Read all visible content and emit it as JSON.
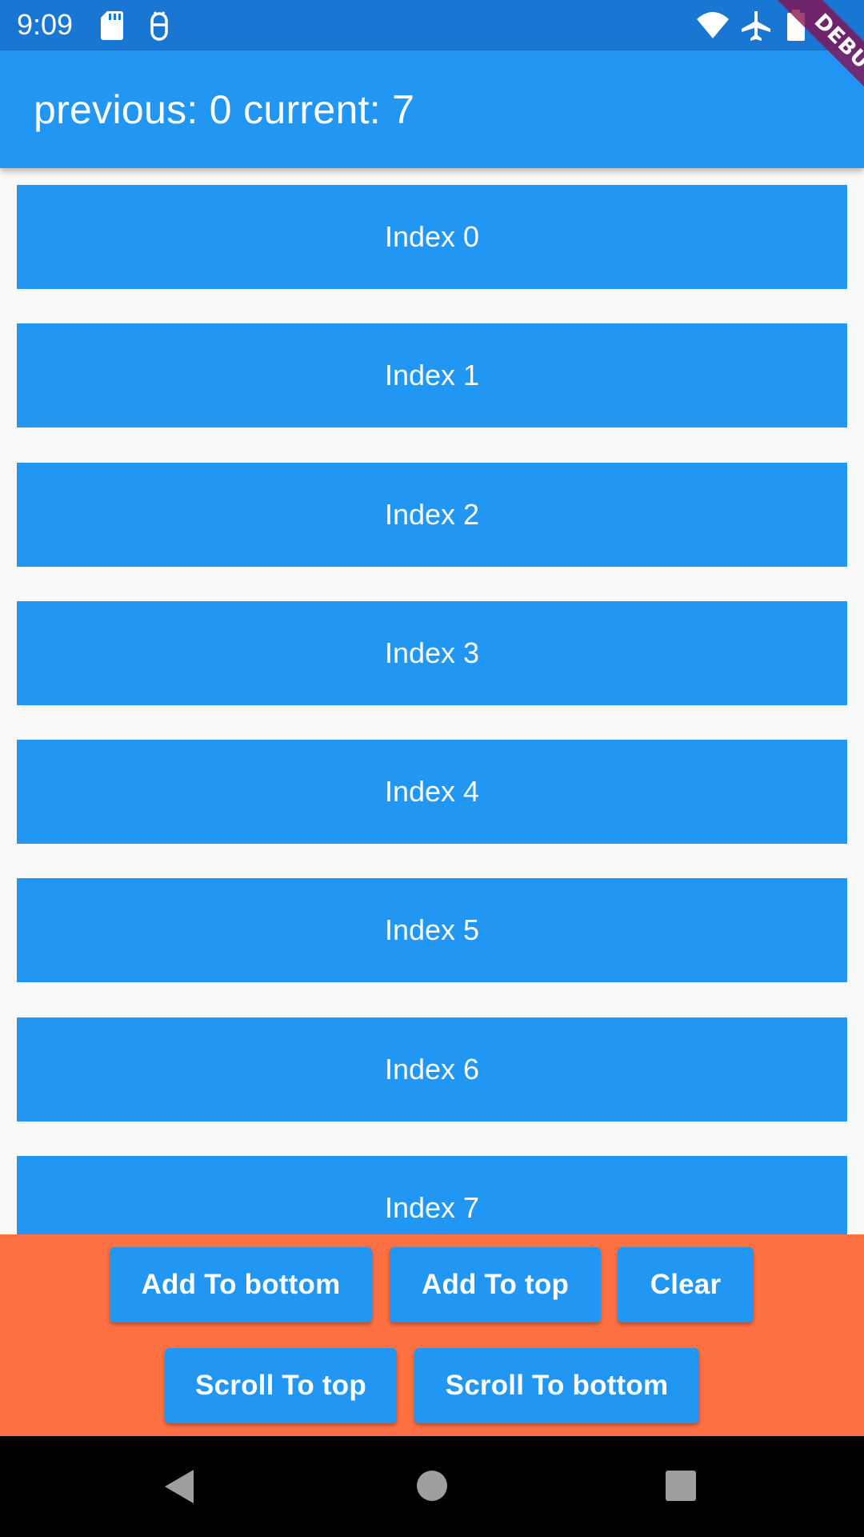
{
  "status_bar": {
    "time": "9:09",
    "icons": [
      "sd-card-icon",
      "android-debug-icon",
      "wifi-icon",
      "airplane-mode-icon",
      "battery-icon"
    ]
  },
  "debug_banner": {
    "label": "DEBUG"
  },
  "app_bar": {
    "title": "previous: 0 current: 7"
  },
  "list": {
    "items": [
      {
        "label": "Index 0"
      },
      {
        "label": "Index 1"
      },
      {
        "label": "Index 2"
      },
      {
        "label": "Index 3"
      },
      {
        "label": "Index 4"
      },
      {
        "label": "Index 5"
      },
      {
        "label": "Index 6"
      },
      {
        "label": "Index 7"
      }
    ]
  },
  "actions": {
    "add_to_bottom": "Add To bottom",
    "add_to_top": "Add To top",
    "clear": "Clear",
    "scroll_to_top": "Scroll To top",
    "scroll_to_bottom": "Scroll To bottom"
  },
  "colors": {
    "status_bar": "#1976d2",
    "primary": "#2196f3",
    "bottom_panel": "#ff7043",
    "background": "#fafafa",
    "nav_bar": "#000000"
  },
  "nav_bar": {
    "icons": [
      "back-icon",
      "home-icon",
      "recents-icon"
    ]
  }
}
